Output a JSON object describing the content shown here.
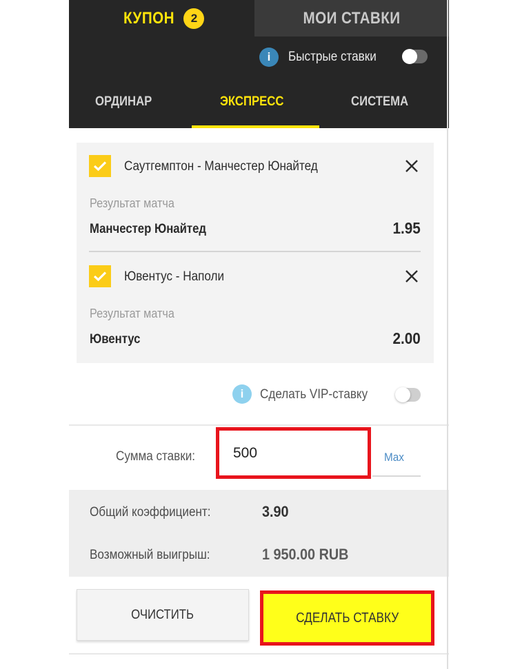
{
  "header": {
    "coupon_label": "КУПОН",
    "coupon_count": "2",
    "my_bets_label": "МОИ СТАВКИ"
  },
  "quick_bets": {
    "label": "Быстрые ставки",
    "enabled": false
  },
  "bet_types": {
    "tabs": [
      "ОРДИНАР",
      "ЭКСПРЕСС",
      "СИСТЕМА"
    ],
    "active": "ЭКСПРЕСС"
  },
  "bets": [
    {
      "event": "Саутгемптон - Манчестер Юнайтед",
      "market": "Результат матча",
      "selection": "Манчестер Юнайтед",
      "odds": "1.95",
      "checked": true
    },
    {
      "event": "Ювентус - Наполи",
      "market": "Результат матча",
      "selection": "Ювентус",
      "odds": "2.00",
      "checked": true
    }
  ],
  "vip": {
    "label": "Сделать VIP-ставку",
    "enabled": false
  },
  "stake": {
    "label": "Сумма ставки:",
    "value": "500",
    "max_label": "Max"
  },
  "summary": {
    "total_odds_label": "Общий коэффициент:",
    "total_odds": "3.90",
    "potential_win_label": "Возможный выигрыш:",
    "potential_win": "1 950.00 RUB"
  },
  "actions": {
    "clear_label": "ОЧИСТИТЬ",
    "place_bet_label": "СДЕЛАТЬ СТАВКУ"
  },
  "colors": {
    "accent_yellow": "#ffe40b",
    "dark_bg": "#262626",
    "highlight_red": "#e8141c",
    "info_blue": "#3a87b8",
    "link_blue": "#4a8bc5"
  },
  "icons": {
    "info": "info-icon",
    "check": "check-icon",
    "close": "close-icon"
  }
}
